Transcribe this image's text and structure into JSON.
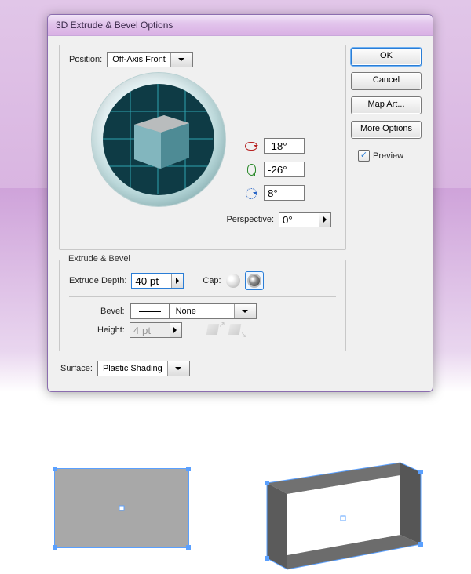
{
  "dialog": {
    "title": "3D Extrude & Bevel Options",
    "position_label": "Position:",
    "position_value": "Off-Axis Front",
    "rotation": {
      "x": "-18°",
      "y": "-26°",
      "z": "8°"
    },
    "perspective_label": "Perspective:",
    "perspective_value": "0°",
    "extrude": {
      "legend": "Extrude & Bevel",
      "depth_label": "Extrude Depth:",
      "depth_value": "40 pt",
      "cap_label": "Cap:",
      "bevel_label": "Bevel:",
      "bevel_value": "None",
      "height_label": "Height:",
      "height_value": "4 pt"
    },
    "surface_label": "Surface:",
    "surface_value": "Plastic Shading"
  },
  "buttons": {
    "ok": "OK",
    "cancel": "Cancel",
    "mapart": "Map Art...",
    "more": "More Options",
    "preview_label": "Preview"
  }
}
